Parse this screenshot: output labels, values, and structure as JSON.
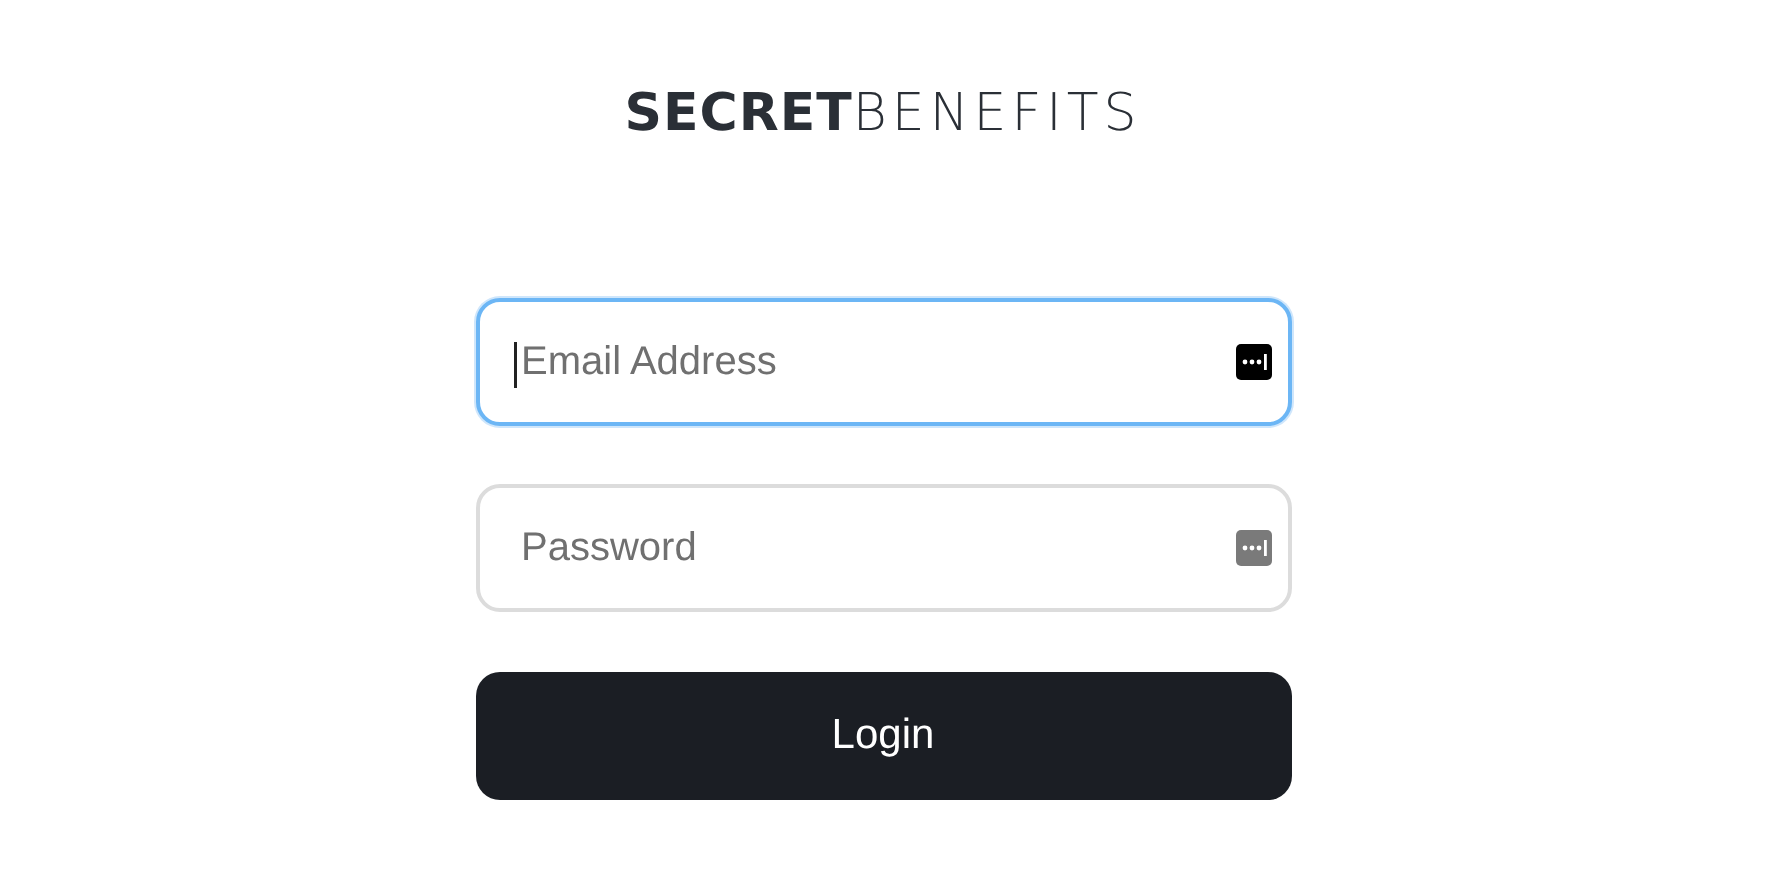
{
  "logo": "**SECRET**BENEFITS",
  "fields": [
    {
      "placeholder": "Email Address",
      "focused": true
    },
    {
      "placeholder": "Password",
      "focused": false
    }
  ],
  "button": {
    "label": "Login"
  }
}
